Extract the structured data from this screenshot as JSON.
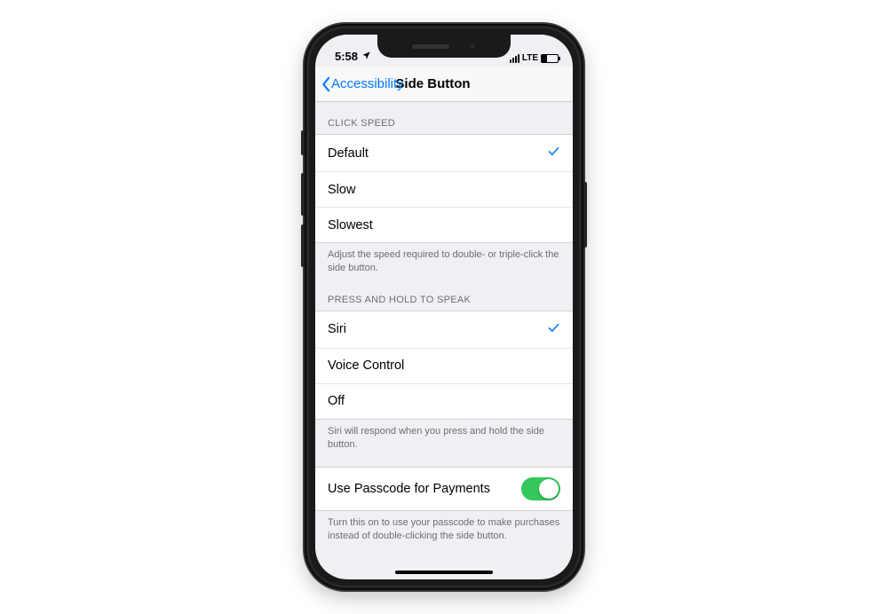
{
  "statusbar": {
    "time": "5:58",
    "location_icon": "location-icon",
    "network_label": "LTE"
  },
  "nav": {
    "back_label": "Accessibility",
    "title": "Side Button"
  },
  "sections": {
    "click_speed": {
      "header": "CLICK SPEED",
      "options": [
        {
          "label": "Default",
          "selected": true
        },
        {
          "label": "Slow",
          "selected": false
        },
        {
          "label": "Slowest",
          "selected": false
        }
      ],
      "footer": "Adjust the speed required to double- or triple-click the side button."
    },
    "press_hold": {
      "header": "PRESS AND HOLD TO SPEAK",
      "options": [
        {
          "label": "Siri",
          "selected": true
        },
        {
          "label": "Voice Control",
          "selected": false
        },
        {
          "label": "Off",
          "selected": false
        }
      ],
      "footer": "Siri will respond when you press and hold the side button."
    },
    "passcode": {
      "row_label": "Use Passcode for Payments",
      "switch_on": true,
      "footer": "Turn this on to use your passcode to make purchases instead of double-clicking the side button."
    }
  },
  "colors": {
    "ios_blue": "#007aff",
    "ios_green": "#34c759",
    "group_bg": "#efeff4"
  }
}
